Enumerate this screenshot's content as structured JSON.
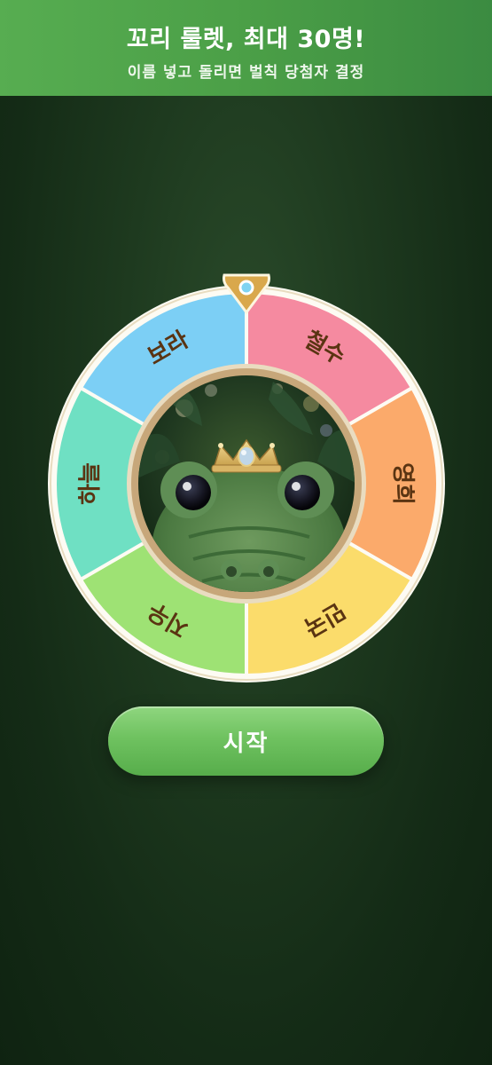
{
  "header": {
    "title": "꼬리 룰렛, 최대 30명!",
    "subtitle": "이름 넣고 돌리면 벌칙 당첨자 결정"
  },
  "wheel": {
    "segments": [
      {
        "label": "철수",
        "color": "#f58aa0"
      },
      {
        "label": "영희",
        "color": "#fbaa6b"
      },
      {
        "label": "민국",
        "color": "#fbdc6b"
      },
      {
        "label": "지우",
        "color": "#9ee274"
      },
      {
        "label": "하늘",
        "color": "#6fe0c3"
      },
      {
        "label": "보라",
        "color": "#7ccff5"
      }
    ],
    "center_image": "crowned-crocodile-plush",
    "pointer_color": "#d9a84c"
  },
  "actions": {
    "start_label": "시작"
  },
  "colors": {
    "header_start": "#57ad51",
    "header_end": "#3b8b41",
    "background": "#1e3a1f",
    "label_text": "#5a3412"
  }
}
